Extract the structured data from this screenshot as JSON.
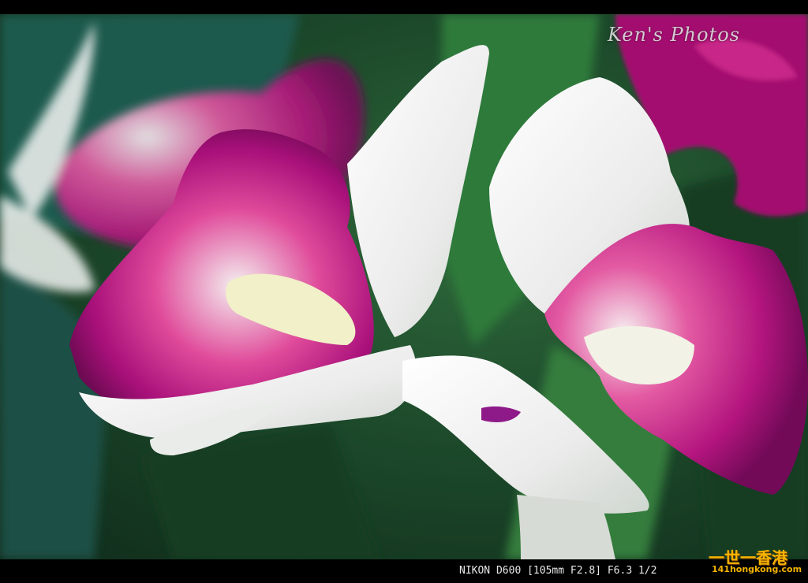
{
  "photo": {
    "subject": "orchid",
    "colors": {
      "petal_magenta": "#b0127a",
      "petal_white": "#f2f2f0",
      "lip_pink": "#e8529f",
      "leaf_green": "#2b6a36",
      "column_cream": "#f1f0c8"
    }
  },
  "watermark": {
    "text": "Ken's Photos"
  },
  "exif": {
    "text": "NIKON D600 [105mm F2.8] F6.3 1/2"
  },
  "logo": {
    "cjk_text": "一世一香港",
    "url_text": "141hongkong.com"
  }
}
